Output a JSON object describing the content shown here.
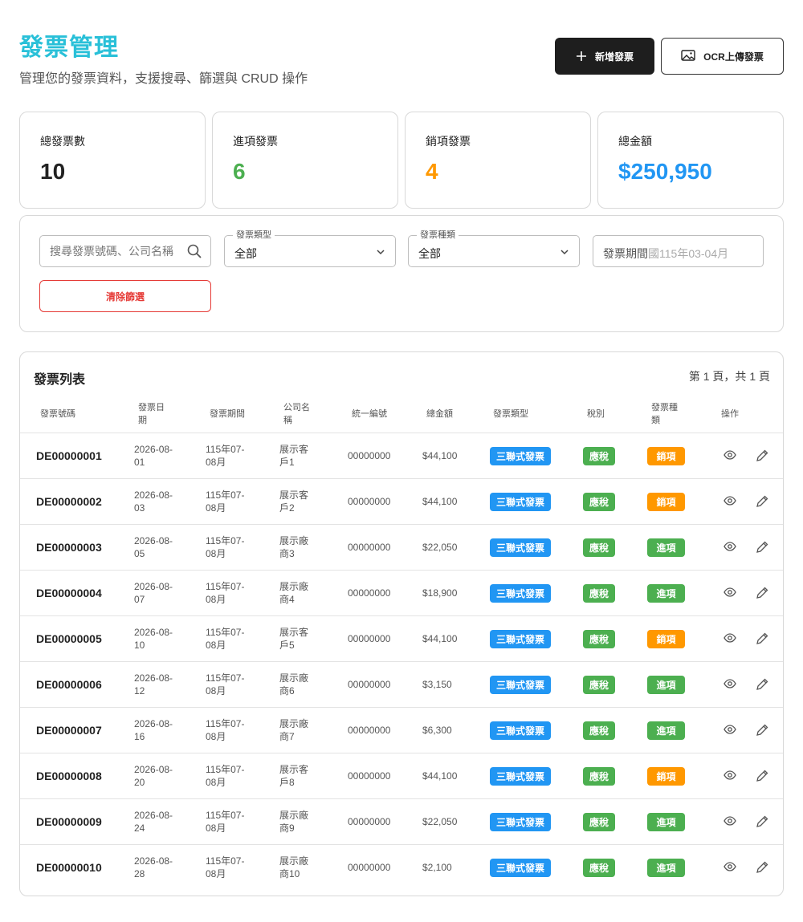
{
  "header": {
    "title": "發票管理",
    "subtitle": "管理您的發票資料，支援搜尋、篩選與 CRUD 操作",
    "add_button": "新增發票",
    "ocr_button": "OCR上傳發票"
  },
  "stats": [
    {
      "label": "總發票數",
      "value": "10",
      "color": "#222222"
    },
    {
      "label": "進項發票",
      "value": "6",
      "color": "#4caf50"
    },
    {
      "label": "銷項發票",
      "value": "4",
      "color": "#ff9800"
    },
    {
      "label": "總金額",
      "value": "$250,950",
      "color": "#2196f3"
    }
  ],
  "filters": {
    "search_placeholder": "搜尋發票號碼、公司名稱",
    "type_label": "發票類型",
    "type_value": "全部",
    "kind_label": "發票種類",
    "kind_value": "全部",
    "period_label": "發票期間",
    "period_placeholder": "國115年03-04月",
    "clear_button": "清除篩選"
  },
  "list": {
    "title": "發票列表",
    "pagination": "第 1 頁，共 1 頁",
    "headers": {
      "no": "發票號碼",
      "date": [
        "發票日",
        "期"
      ],
      "period": "發票期間",
      "company": [
        "公司名",
        "稱"
      ],
      "tax_id": "統一編號",
      "total": "總金額",
      "type": "發票類型",
      "tax": "稅別",
      "kind": [
        "發票種",
        "類"
      ],
      "actions": "操作"
    },
    "rows": [
      {
        "no": "DE00000001",
        "date": [
          "2026-08-",
          "01"
        ],
        "period": [
          "115年07-",
          "08月"
        ],
        "company": [
          "展示客",
          "戶1"
        ],
        "tax_id": "00000000",
        "total": "$44,100",
        "type": "三聯式發票",
        "tax": "應稅",
        "kind": "銷項",
        "kind_color": "#ff9800"
      },
      {
        "no": "DE00000002",
        "date": [
          "2026-08-",
          "03"
        ],
        "period": [
          "115年07-",
          "08月"
        ],
        "company": [
          "展示客",
          "戶2"
        ],
        "tax_id": "00000000",
        "total": "$44,100",
        "type": "三聯式發票",
        "tax": "應稅",
        "kind": "銷項",
        "kind_color": "#ff9800"
      },
      {
        "no": "DE00000003",
        "date": [
          "2026-08-",
          "05"
        ],
        "period": [
          "115年07-",
          "08月"
        ],
        "company": [
          "展示廠",
          "商3"
        ],
        "tax_id": "00000000",
        "total": "$22,050",
        "type": "三聯式發票",
        "tax": "應稅",
        "kind": "進項",
        "kind_color": "#4caf50"
      },
      {
        "no": "DE00000004",
        "date": [
          "2026-08-",
          "07"
        ],
        "period": [
          "115年07-",
          "08月"
        ],
        "company": [
          "展示廠",
          "商4"
        ],
        "tax_id": "00000000",
        "total": "$18,900",
        "type": "三聯式發票",
        "tax": "應稅",
        "kind": "進項",
        "kind_color": "#4caf50"
      },
      {
        "no": "DE00000005",
        "date": [
          "2026-08-",
          "10"
        ],
        "period": [
          "115年07-",
          "08月"
        ],
        "company": [
          "展示客",
          "戶5"
        ],
        "tax_id": "00000000",
        "total": "$44,100",
        "type": "三聯式發票",
        "tax": "應稅",
        "kind": "銷項",
        "kind_color": "#ff9800"
      },
      {
        "no": "DE00000006",
        "date": [
          "2026-08-",
          "12"
        ],
        "period": [
          "115年07-",
          "08月"
        ],
        "company": [
          "展示廠",
          "商6"
        ],
        "tax_id": "00000000",
        "total": "$3,150",
        "type": "三聯式發票",
        "tax": "應稅",
        "kind": "進項",
        "kind_color": "#4caf50"
      },
      {
        "no": "DE00000007",
        "date": [
          "2026-08-",
          "16"
        ],
        "period": [
          "115年07-",
          "08月"
        ],
        "company": [
          "展示廠",
          "商7"
        ],
        "tax_id": "00000000",
        "total": "$6,300",
        "type": "三聯式發票",
        "tax": "應稅",
        "kind": "進項",
        "kind_color": "#4caf50"
      },
      {
        "no": "DE00000008",
        "date": [
          "2026-08-",
          "20"
        ],
        "period": [
          "115年07-",
          "08月"
        ],
        "company": [
          "展示客",
          "戶8"
        ],
        "tax_id": "00000000",
        "total": "$44,100",
        "type": "三聯式發票",
        "tax": "應稅",
        "kind": "銷項",
        "kind_color": "#ff9800"
      },
      {
        "no": "DE00000009",
        "date": [
          "2026-08-",
          "24"
        ],
        "period": [
          "115年07-",
          "08月"
        ],
        "company": [
          "展示廠",
          "商9"
        ],
        "tax_id": "00000000",
        "total": "$22,050",
        "type": "三聯式發票",
        "tax": "應稅",
        "kind": "進項",
        "kind_color": "#4caf50"
      },
      {
        "no": "DE00000010",
        "date": [
          "2026-08-",
          "28"
        ],
        "period": [
          "115年07-",
          "08月"
        ],
        "company": [
          "展示廠",
          "商10"
        ],
        "tax_id": "00000000",
        "total": "$2,100",
        "type": "三聯式發票",
        "tax": "應稅",
        "kind": "進項",
        "kind_color": "#4caf50"
      }
    ]
  },
  "icons": {
    "add": "plus-icon",
    "ocr": "image-icon",
    "search": "search-icon",
    "select": "chevron-down-icon",
    "view": "eye-icon",
    "edit": "pencil-icon"
  }
}
